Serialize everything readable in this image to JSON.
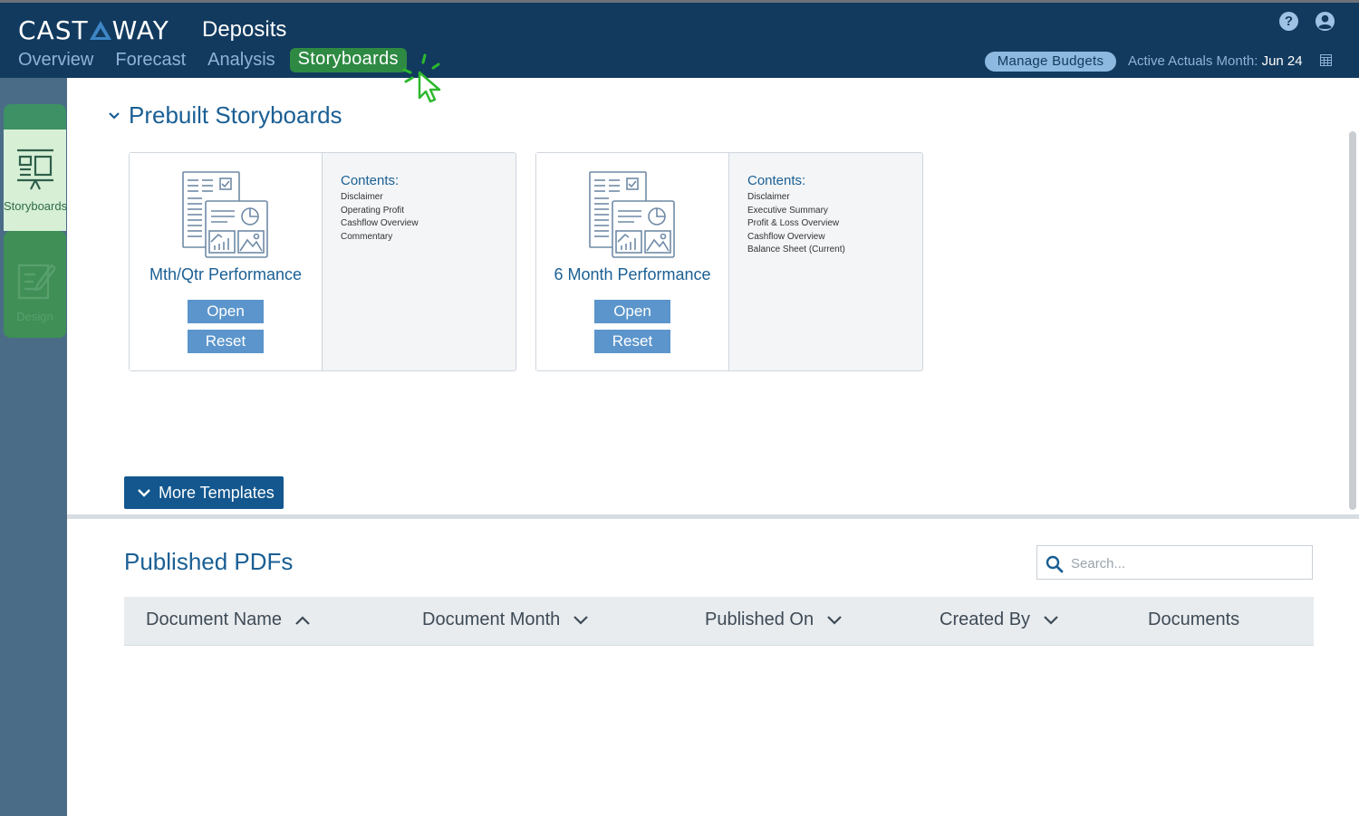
{
  "header": {
    "logo_left": "CAST",
    "logo_right": "WAY",
    "app_title": "Deposits",
    "nav": [
      {
        "label": "Overview",
        "active": false
      },
      {
        "label": "Forecast",
        "active": false
      },
      {
        "label": "Analysis",
        "active": false
      },
      {
        "label": "Storyboards",
        "active": true
      }
    ],
    "manage_budgets": "Manage Budgets",
    "active_actuals_label": "Active Actuals Month:",
    "active_actuals_value": "Jun 24",
    "help_glyph": "?"
  },
  "sidebar": {
    "items": [
      {
        "label": "Storyboards",
        "icon": "presentation-board-icon",
        "active": true
      },
      {
        "label": "Design",
        "icon": "edit-document-icon",
        "active": false
      }
    ]
  },
  "prebuilt": {
    "title": "Prebuilt Storyboards",
    "cards": [
      {
        "name": "Mth/Qtr Performance",
        "open_label": "Open",
        "reset_label": "Reset",
        "contents_heading": "Contents:",
        "contents": [
          "Disclaimer",
          "Operating Profit",
          "Cashflow Overview",
          "Commentary"
        ]
      },
      {
        "name": "6 Month Performance",
        "open_label": "Open",
        "reset_label": "Reset",
        "contents_heading": "Contents:",
        "contents": [
          "Disclaimer",
          "Executive Summary",
          "Profit & Loss Overview",
          "Cashflow Overview",
          "Balance Sheet (Current)"
        ]
      }
    ],
    "more_templates": "More Templates"
  },
  "published": {
    "title": "Published PDFs",
    "search_placeholder": "Search...",
    "columns": [
      {
        "label": "Document Name",
        "sort": "asc"
      },
      {
        "label": "Document Month",
        "sort": "desc"
      },
      {
        "label": "Published On",
        "sort": "desc"
      },
      {
        "label": "Created By",
        "sort": "desc"
      },
      {
        "label": "Documents",
        "sort": "none"
      }
    ]
  },
  "colors": {
    "header_bg": "#123a5e",
    "accent_blue": "#1a5f94",
    "active_green": "#2e8a43",
    "button_blue": "#5b95cb"
  }
}
